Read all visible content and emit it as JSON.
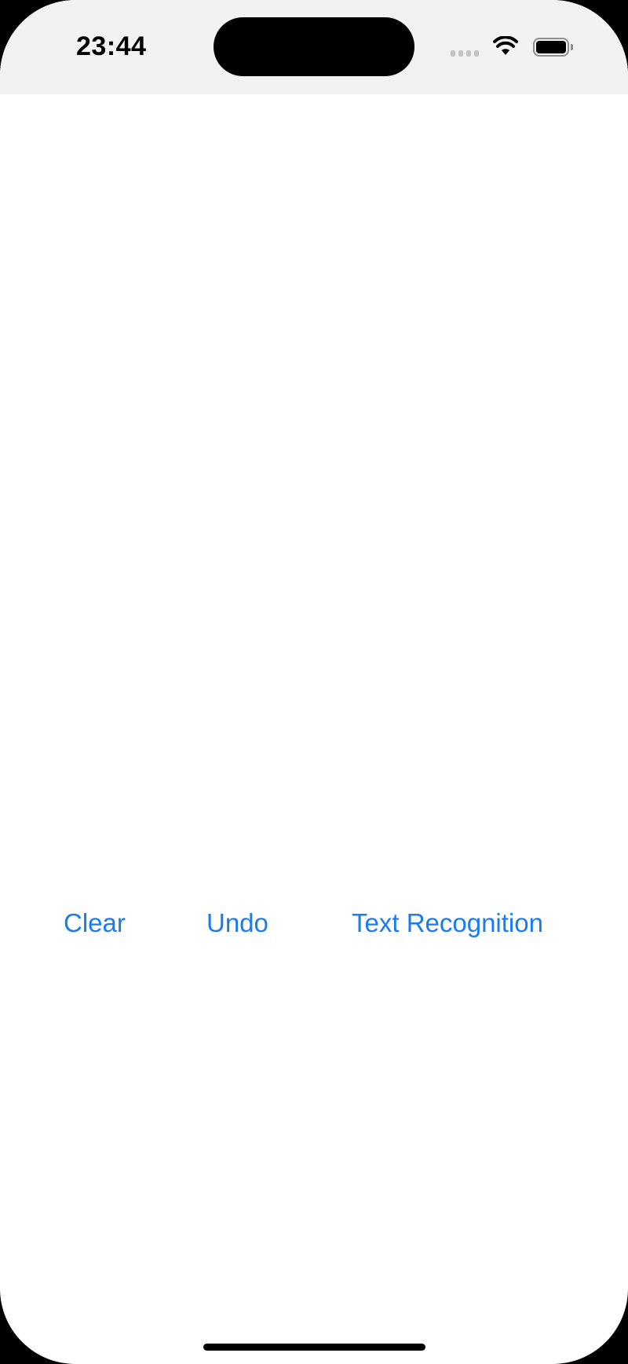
{
  "status_bar": {
    "time": "23:44",
    "icons": [
      "cellular-signal-icon",
      "wifi-icon",
      "battery-icon"
    ]
  },
  "toolbar": {
    "clear_label": "Clear",
    "undo_label": "Undo",
    "text_recognition_label": "Text Recognition"
  },
  "colors": {
    "accent": "#1a7cf0",
    "status_bar_bg": "#f2f2f2",
    "background": "#ffffff"
  }
}
